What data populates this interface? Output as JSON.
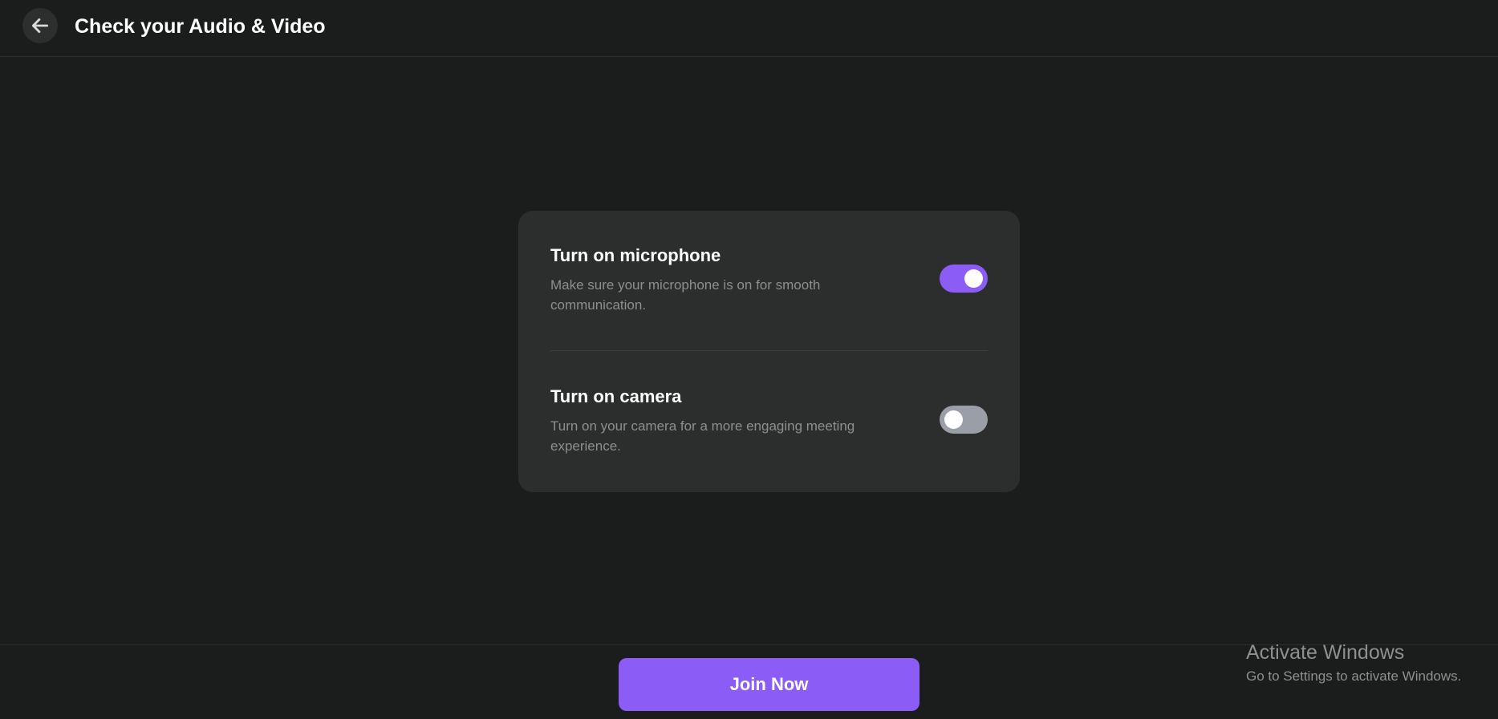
{
  "header": {
    "title": "Check your Audio & Video",
    "back_icon": "arrow-left-icon"
  },
  "settings": [
    {
      "title": "Turn on microphone",
      "description": "Make sure your microphone is on for smooth communication.",
      "enabled": true
    },
    {
      "title": "Turn on camera",
      "description": "Turn on your camera for a more engaging meeting experience.",
      "enabled": false
    }
  ],
  "footer": {
    "join_label": "Join Now"
  },
  "watermark": {
    "title": "Activate Windows",
    "subtitle": "Go to Settings to activate Windows."
  },
  "colors": {
    "background": "#1b1c1c",
    "card": "#2c2d2d",
    "accent": "#8b5cf6",
    "toggle_off": "#9a9ea6"
  }
}
